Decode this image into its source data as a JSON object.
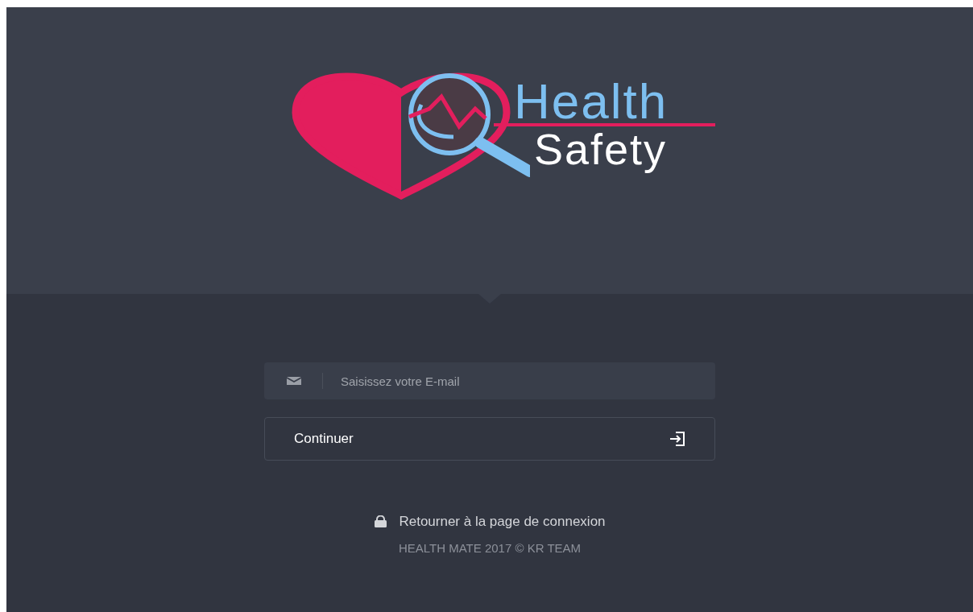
{
  "logo": {
    "title": "Health",
    "subtitle": "Safety"
  },
  "email_field": {
    "placeholder": "Saisissez votre E-mail"
  },
  "continue_button": {
    "label": "Continuer"
  },
  "back_link": {
    "label": "Retourner à la page de connexion"
  },
  "footer": {
    "text": "HEALTH MATE 2017 © KR TEAM"
  }
}
